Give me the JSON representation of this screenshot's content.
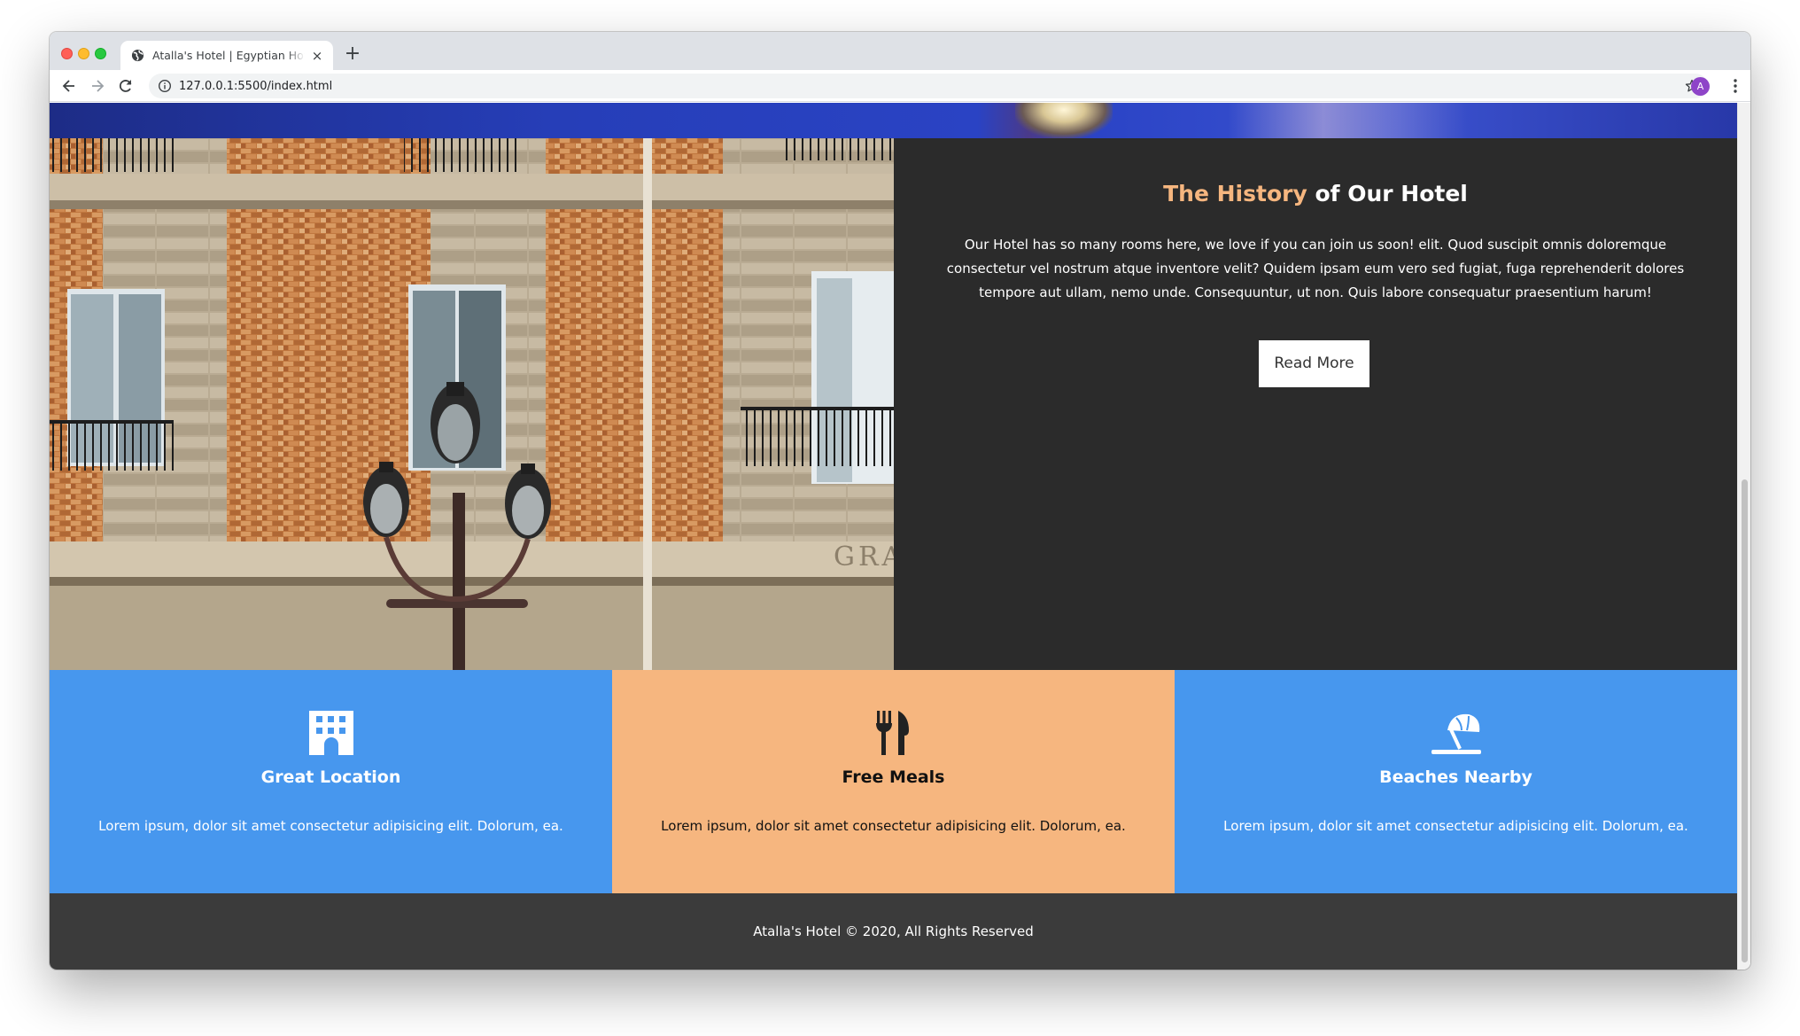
{
  "browser": {
    "tab_title": "Atalla's Hotel | Egyptian Hotel",
    "tab_close": "×",
    "new_tab": "+",
    "url": "127.0.0.1:5500/index.html",
    "avatar_letter": "A",
    "icons": [
      "globe-icon",
      "back-icon",
      "forward-icon",
      "reload-icon",
      "info-icon",
      "star-icon",
      "menu-icon"
    ]
  },
  "history": {
    "title_accent": "The History",
    "title_rest": " of Our Hotel",
    "body": "Our Hotel has so many rooms here, we love if you can join us soon! elit. Quod suscipit omnis doloremque consectetur vel nostrum atque inventore velit? Quidem ipsam eum vero sed fugiat, fuga reprehenderit dolores tempore aut ullam, nemo unde. Consequuntur, ut non. Quis labore consequatur praesentium harum!",
    "button": "Read More",
    "accent_color": "#f6b67f"
  },
  "features": [
    {
      "title": "Great Location",
      "text": "Lorem ipsum, dolor sit amet consectetur adipisicing elit. Dolorum, ea.",
      "icon": "building-icon",
      "color": "#4797ee"
    },
    {
      "title": "Free Meals",
      "text": "Lorem ipsum, dolor sit amet consectetur adipisicing elit. Dolorum, ea.",
      "icon": "utensils-icon",
      "color": "#f6b67f"
    },
    {
      "title": "Beaches Nearby",
      "text": "Lorem ipsum, dolor sit amet consectetur adipisicing elit. Dolorum, ea.",
      "icon": "umbrella-beach-icon",
      "color": "#4797ee"
    }
  ],
  "footer": {
    "text": "Atalla's Hotel © 2020, All Rights Reserved"
  }
}
